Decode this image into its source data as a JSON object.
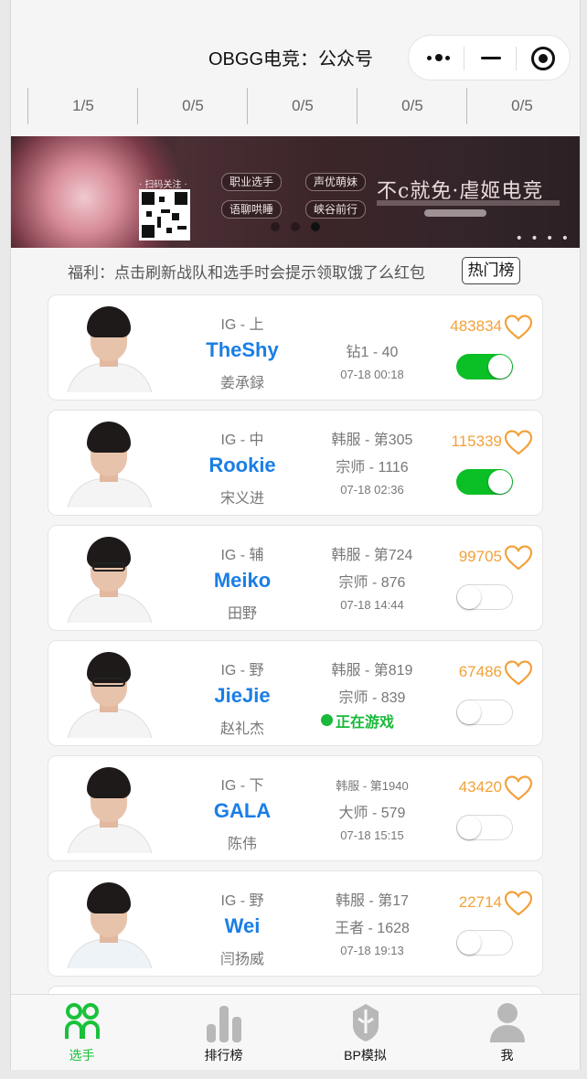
{
  "header": {
    "title": "OBGG电竞：公众号"
  },
  "counters": [
    "1/5",
    "0/5",
    "0/5",
    "0/5",
    "0/5"
  ],
  "banner": {
    "qr_label": "· 扫码关注 ·",
    "tags": [
      "职业选手",
      "声优萌妹",
      "语聊哄睡",
      "峡谷前行"
    ],
    "slogan": "不c就免·虐姬电竞",
    "active_dot": 3,
    "more": "• • • •"
  },
  "notice": "福利：点击刷新战队和选手时会提示领取饿了么红包",
  "hot_button": "热门榜",
  "players": [
    {
      "team_pos": "IG - 上",
      "ign": "TheShy",
      "real": "姜承録",
      "rank1": "",
      "rank2": "钻1 - 40",
      "rank3": "07-18 00:18",
      "in_game": "",
      "score": "483834",
      "toggle_on": true
    },
    {
      "team_pos": "IG - 中",
      "ign": "Rookie",
      "real": "宋义进",
      "rank1": "韩服 - 第305",
      "rank2": "宗师 - 1116",
      "rank3": "07-18 02:36",
      "in_game": "",
      "score": "115339",
      "toggle_on": true
    },
    {
      "team_pos": "IG - 辅",
      "ign": "Meiko",
      "real": "田野",
      "rank1": "韩服 - 第724",
      "rank2": "宗师 - 876",
      "rank3": "07-18 14:44",
      "in_game": "",
      "score": "99705",
      "toggle_on": false
    },
    {
      "team_pos": "IG - 野",
      "ign": "JieJie",
      "real": "赵礼杰",
      "rank1": "韩服 - 第819",
      "rank2": "宗师 - 839",
      "rank3": "",
      "in_game": "正在游戏",
      "score": "67486",
      "toggle_on": false
    },
    {
      "team_pos": "IG - 下",
      "ign": "GALA",
      "real": "陈伟",
      "rank1": "韩服 - 第1940",
      "rank2": "大师 - 579",
      "rank3": "07-18 15:15",
      "in_game": "",
      "score": "43420",
      "toggle_on": false
    },
    {
      "team_pos": "IG - 野",
      "ign": "Wei",
      "real": "闫扬威",
      "rank1": "韩服 - 第17",
      "rank2": "王者 - 1628",
      "rank3": "07-18 19:13",
      "in_game": "",
      "score": "22714",
      "toggle_on": false
    }
  ],
  "tabs": [
    {
      "label": "选手",
      "icon": "players-icon",
      "active": true
    },
    {
      "label": "排行榜",
      "icon": "ranking-icon",
      "active": false
    },
    {
      "label": "BP模拟",
      "icon": "bp-helmet-icon",
      "active": false
    },
    {
      "label": "我",
      "icon": "profile-icon",
      "active": false
    }
  ],
  "colors": {
    "accent_blue": "#1a7ee6",
    "score_orange": "#f2a13a",
    "toggle_green": "#0bbf26",
    "tab_active": "#19c13a"
  }
}
